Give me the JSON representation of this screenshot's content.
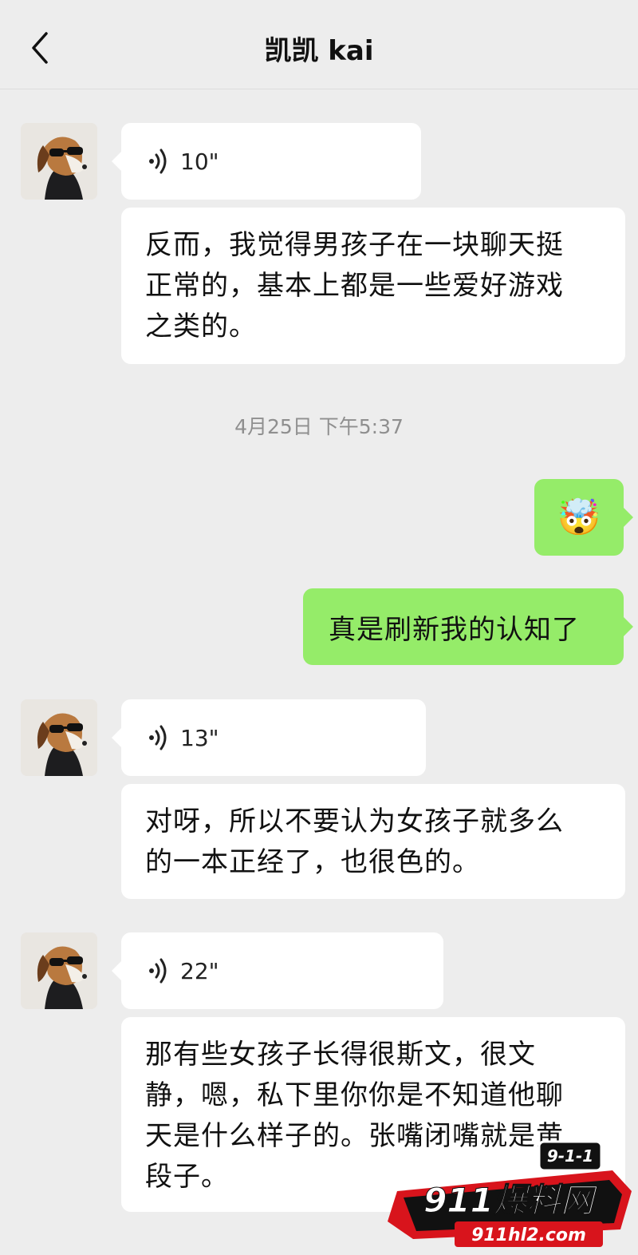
{
  "header": {
    "title": "凯凯 kai",
    "back_icon": "chevron-left-icon"
  },
  "timestamp": "4月25日 下午5:37",
  "messages": [
    {
      "side": "left",
      "type": "voice",
      "duration": "10\""
    },
    {
      "side": "left",
      "type": "text",
      "lines": [
        "反而，我觉得男孩子在一块聊天挺",
        "正常的，基本上都是一些爱好游戏",
        "之类的。"
      ]
    },
    {
      "side": "right",
      "type": "emoji",
      "emoji": "🤯"
    },
    {
      "side": "right",
      "type": "text",
      "text": "真是刷新我的认知了"
    },
    {
      "side": "left",
      "type": "voice",
      "duration": "13\""
    },
    {
      "side": "left",
      "type": "text",
      "lines": [
        "对呀，所以不要认为女孩子就多么",
        "的一本正经了，也很色的。"
      ]
    },
    {
      "side": "left",
      "type": "voice",
      "duration": "22\""
    },
    {
      "side": "left",
      "type": "text",
      "lines": [
        "那有些女孩子长得很斯文，很文",
        "静，嗯，私下里你你是不知道他聊",
        "天是什么样子的。张嘴闭嘴就是黄",
        "段子。"
      ]
    }
  ],
  "watermark": {
    "badge": "9-1-1",
    "brand": "911爆料网",
    "url": "911hl2.com"
  },
  "colors": {
    "background": "#ededed",
    "incoming_bubble": "#ffffff",
    "outgoing_bubble": "#95ec69",
    "watermark_red": "#d8141c"
  }
}
